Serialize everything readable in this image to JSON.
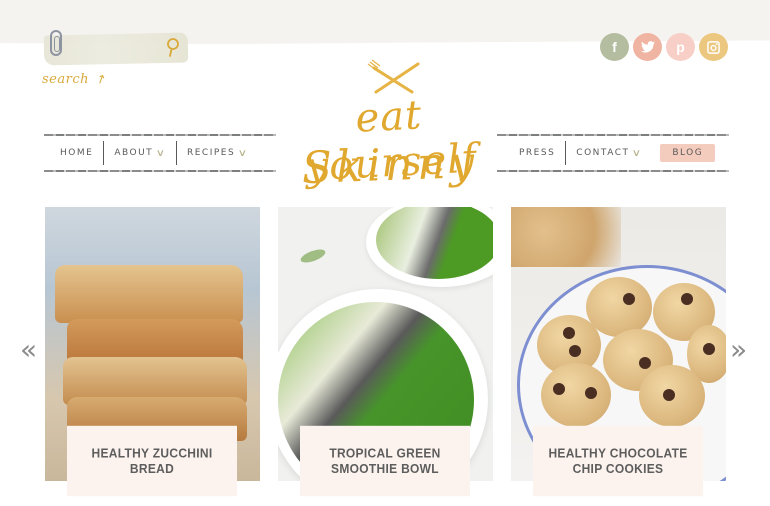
{
  "header": {
    "search": {
      "placeholder": "",
      "label": "search",
      "arrow": "↗"
    },
    "logo": {
      "line1": "eat yourself",
      "line2": "Skinny"
    },
    "social": [
      {
        "name": "facebook",
        "glyph": "f",
        "color": "#b4bda0"
      },
      {
        "name": "twitter",
        "glyph": "t",
        "color": "#f0b4a2"
      },
      {
        "name": "pinterest",
        "glyph": "p",
        "color": "#f7cfc6"
      },
      {
        "name": "instagram",
        "glyph": "◙",
        "color": "#ecc77f"
      }
    ]
  },
  "nav": {
    "left": [
      {
        "label": "HOME",
        "has_dropdown": false
      },
      {
        "label": "ABOUT",
        "has_dropdown": true
      },
      {
        "label": "RECIPES",
        "has_dropdown": true
      }
    ],
    "right": [
      {
        "label": "PRESS",
        "has_dropdown": false
      },
      {
        "label": "CONTACT",
        "has_dropdown": true
      },
      {
        "label": "BLOG",
        "has_dropdown": false,
        "highlighted": true
      }
    ],
    "chevron": "∨",
    "highlight_color": "#f4ccbd"
  },
  "carousel": {
    "prev": "«",
    "next": "»",
    "cards": [
      {
        "title": "HEALTHY ZUCCHINI BREAD",
        "image": "zucchini-bread-photo"
      },
      {
        "title": "TROPICAL GREEN SMOOTHIE BOWL",
        "image": "green-smoothie-bowl-photo"
      },
      {
        "title": "HEALTHY CHOCOLATE CHIP COOKIES",
        "image": "chocolate-chip-cookies-photo"
      }
    ]
  },
  "colors": {
    "gold": "#e0a82e",
    "caption_bg": "#fcf3ef",
    "text": "#5a5a5a"
  }
}
